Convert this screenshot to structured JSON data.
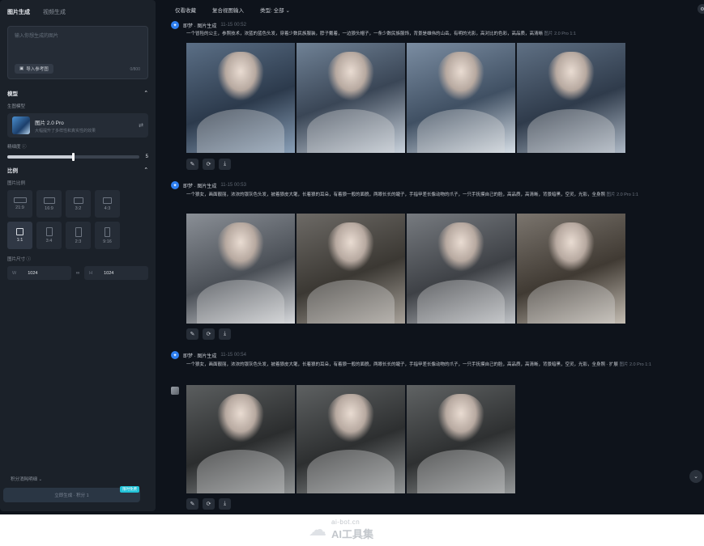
{
  "left_panel": {
    "tabs": [
      "图片生成",
      "视频生成"
    ],
    "prompt_placeholder": "输入你想生成的图片",
    "ref_button": "导入参考图",
    "char_count": "0/800",
    "model_section": "模型",
    "gen_model_label": "生图模型",
    "model_name": "图片 2.0 Pro",
    "model_desc": "大幅提升了多样性和真实性的效果",
    "precision_label": "精细度",
    "precision_value": "5",
    "precision_fraction": 0.5,
    "ratio_section": "比例",
    "ratio_label": "图片比例",
    "ratios": [
      "21:9",
      "16:9",
      "3:2",
      "4:3",
      "1:1",
      "3:4",
      "2:3",
      "9:16"
    ],
    "active_ratio": "1:1",
    "size_label": "图片尺寸",
    "width_label": "W",
    "width_value": "1024",
    "height_label": "H",
    "height_value": "1024",
    "bottom_label": "积分消耗明细",
    "generate_button": "立即生成 · 积分 1",
    "vip_badge": "限时免费"
  },
  "topbar": {
    "items": [
      "仅看收藏",
      "复合视图输入",
      "类型: 全部"
    ]
  },
  "entries": [
    {
      "title": "即梦 · 图片生成",
      "time": "11-15 00:52",
      "prompt": "一个冒险的公主，参照技术，浓蓝的蓝色头发，穿着少数民族服装，脖子戴着，一边狼头帽子，一条少数民族服饰，背景是雄伟的山岳，有明的光影，高对比的色彩，高品质，高清晰",
      "model": "图片 2.0 Pro",
      "ratio": "1:1"
    },
    {
      "title": "即梦 · 图片生成",
      "time": "11-15 00:53",
      "prompt": "一个狼女，画面靓丽，浓浓的银灰色头发，披着狼皮大氅，长着狼的耳朵，有着狼一般的面貌，两眼长长的睫子，手指甲差长像动物的爪子，一只手抚摸自己的脸，高品质，高清晰，背景暗黑，空灵，光影，全身照",
      "model": "图片 2.0 Pro",
      "ratio": "1:1"
    },
    {
      "title": "即梦 · 图片生成",
      "time": "11-15 00:54",
      "prompt": "一个狼女，画面靓丽，浓浓的银灰色头发，披着狼皮大氅，长着狼的耳朵，有着狼一般的面貌，两眼长长的睫子，手指甲差长像动物的爪子，一只手抚摸自己的脸，高品质，高清晰，背景暗黑，空灵，光影，全身照 · 扩展",
      "model": "图片 2.0 Pro",
      "ratio": "1:1"
    }
  ],
  "icons": {
    "edit": "pencil-icon",
    "regenerate": "refresh-icon",
    "download": "download-icon"
  },
  "watermark": {
    "url": "ai-bot.cn",
    "name": "AI工具集"
  },
  "colors": {
    "accent": "#2e7ff0",
    "badge": "#22c3d8"
  }
}
